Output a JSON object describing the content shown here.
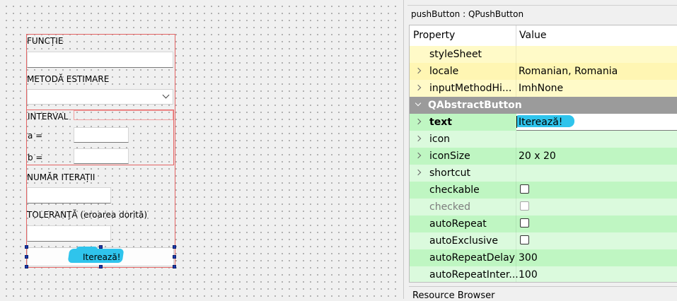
{
  "form": {
    "function_label": "FUNCȚIE",
    "method_label": "METODĂ ESTIMARE",
    "interval_label": "INTERVAL",
    "a_label": "a =",
    "b_label": "b =",
    "iterations_label": "NUMĂR ITERAȚII",
    "tolerance_label": "TOLERANȚĂ (eroarea dorită)",
    "iterate_button": "Iterează!"
  },
  "property_editor": {
    "object_title": "pushButton : QPushButton",
    "columns": {
      "property": "Property",
      "value": "Value"
    },
    "rows": {
      "stylesheet": {
        "name": "styleSheet",
        "value": ""
      },
      "locale": {
        "name": "locale",
        "value": "Romanian, Romania"
      },
      "input_method_hints": {
        "name": "inputMethodHi...",
        "value": "ImhNone"
      },
      "section": {
        "name": "QAbstractButton"
      },
      "text": {
        "name": "text",
        "value": "Iterează!"
      },
      "icon": {
        "name": "icon",
        "value": ""
      },
      "icon_size": {
        "name": "iconSize",
        "value": "20 x 20"
      },
      "shortcut": {
        "name": "shortcut",
        "value": ""
      },
      "checkable": {
        "name": "checkable",
        "checked": false
      },
      "checked": {
        "name": "checked",
        "checked": false
      },
      "auto_repeat": {
        "name": "autoRepeat",
        "checked": false
      },
      "auto_exclusive": {
        "name": "autoExclusive",
        "checked": false
      },
      "auto_repeat_delay": {
        "name": "autoRepeatDelay",
        "value": "300"
      },
      "auto_repeat_interval": {
        "name": "autoRepeatInter...",
        "value": "100"
      }
    }
  },
  "resource_browser": {
    "title": "Resource Browser"
  },
  "colors": {
    "highlight": "#2fc4ec",
    "selection_box": "#e46464",
    "handle": "#1c3aa9",
    "section_header": "#9b9b9b",
    "row_yellow": "#fffac8",
    "row_green": "#bff6c2"
  }
}
